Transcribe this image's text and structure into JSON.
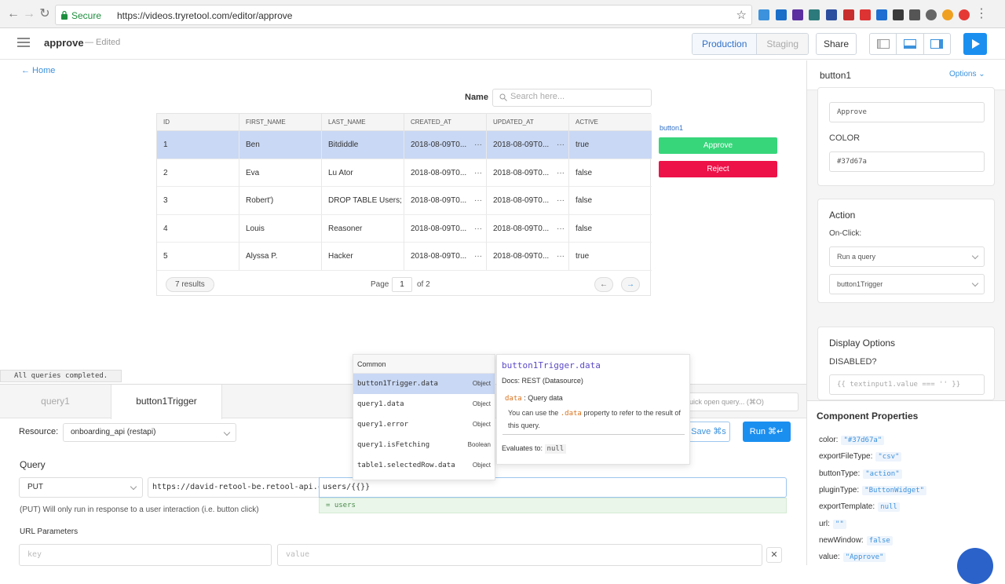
{
  "browser": {
    "secure_label": "Secure",
    "url": "https://videos.tryretool.com/editor/approve"
  },
  "header": {
    "app_name": "approve",
    "edited": "— Edited",
    "env_production": "Production",
    "env_staging": "Staging",
    "share": "Share"
  },
  "canvas": {
    "home_link": "← Home",
    "name_label": "Name",
    "search_placeholder": "Search here...",
    "table": {
      "columns": [
        "ID",
        "FIRST_NAME",
        "LAST_NAME",
        "CREATED_AT",
        "UPDATED_AT",
        "ACTIVE"
      ],
      "rows": [
        [
          "1",
          "Ben",
          "Bitdiddle",
          "2018-08-09T0...",
          "2018-08-09T0...",
          "true"
        ],
        [
          "2",
          "Eva",
          "Lu Ator",
          "2018-08-09T0...",
          "2018-08-09T0...",
          "false"
        ],
        [
          "3",
          "Robert')",
          "DROP TABLE Users;",
          "2018-08-09T0...",
          "2018-08-09T0...",
          "false"
        ],
        [
          "4",
          "Louis",
          "Reasoner",
          "2018-08-09T0...",
          "2018-08-09T0...",
          "false"
        ],
        [
          "5",
          "Alyssa P.",
          "Hacker",
          "2018-08-09T0...",
          "2018-08-09T0...",
          "true"
        ]
      ],
      "ellipsis": "···",
      "results": "7 results",
      "page_label": "Page",
      "page_value": "1",
      "page_of": "of 2",
      "prev": "←",
      "next": "→"
    },
    "button_tag": "button1",
    "approve": "Approve",
    "reject": "Reject"
  },
  "status": "All queries completed.",
  "bottom": {
    "tab_query1": "query1",
    "tab_button1Trigger": "button1Trigger",
    "quick_open": "uick open query... (⌘O)",
    "resource_label": "Resource:",
    "resource_value": "onboarding_api (restapi)",
    "save": "Save ⌘s",
    "run": "Run ⌘↵",
    "query_label": "Query",
    "method": "PUT",
    "url_base": "https://david-retool-be.retool-api.com/",
    "url_path": "users/{{}}",
    "url_preview": "= users",
    "put_note": "(PUT) Will only run in response to a user interaction (i.e. button click)",
    "url_params_label": "URL Parameters",
    "key_placeholder": "key",
    "value_placeholder": "value",
    "remove": "✕"
  },
  "autocomplete": {
    "title": "Common",
    "items": [
      {
        "name": "button1Trigger.data",
        "type": "Object"
      },
      {
        "name": "query1.data",
        "type": "Object"
      },
      {
        "name": "query1.error",
        "type": "Object"
      },
      {
        "name": "query1.isFetching",
        "type": "Boolean"
      },
      {
        "name": "table1.selectedRow.data",
        "type": "Object"
      }
    ],
    "doc": {
      "title": "button1Trigger.data",
      "docs": "Docs: REST (Datasource)",
      "prop_key": "data",
      "prop_desc": " : Query data",
      "desc_1": "You can use the ",
      "desc_code": ".data",
      "desc_2": " property to refer to the result of this query.",
      "evaluates_label": "Evaluates to: ",
      "evaluates_value": "null"
    }
  },
  "right_panel": {
    "component": "button1",
    "options": "Options ⌄",
    "text_value": "Approve",
    "color_label": "COLOR",
    "color_value": "#37d67a",
    "action_title": "Action",
    "onclick_label": "On-Click:",
    "onclick_value": "Run a query",
    "query_value": "button1Trigger",
    "display_title": "Display Options",
    "disabled_label": "DISABLED?",
    "disabled_value": "{{ textinput1.value === '' }}",
    "props_title": "Component Properties",
    "props": [
      {
        "key": "color:",
        "value": "\"#37d67a\""
      },
      {
        "key": "exportFileType:",
        "value": "\"csv\""
      },
      {
        "key": "buttonType:",
        "value": "\"action\""
      },
      {
        "key": "pluginType:",
        "value": "\"ButtonWidget\""
      },
      {
        "key": "exportTemplate:",
        "value": "null"
      },
      {
        "key": "url:",
        "value": "\"\""
      },
      {
        "key": "newWindow:",
        "value": "false"
      },
      {
        "key": "value:",
        "value": "\"Approve\""
      }
    ]
  },
  "colors": {
    "approve": "#37d67a",
    "reject": "#ed1248",
    "accent": "#1a8ff0",
    "selected_row": "#c9d8f4"
  }
}
